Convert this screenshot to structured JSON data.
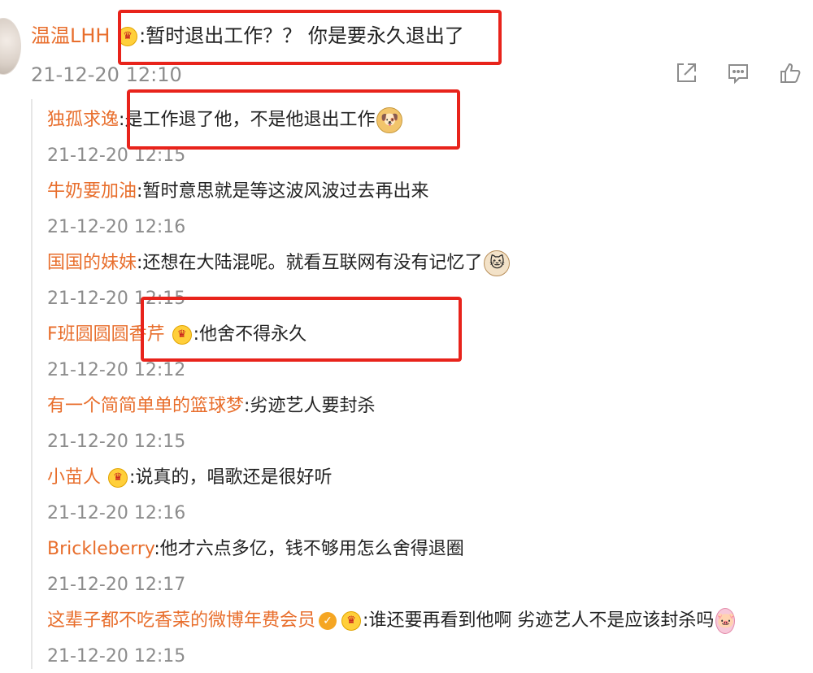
{
  "main_comment": {
    "username": "温温LHH",
    "separator": ":",
    "text": "暂时退出工作？？ 你是要永久退出了",
    "timestamp": "21-12-20 12:10",
    "actions": [
      {
        "icon": "share-icon"
      },
      {
        "icon": "comment-icon"
      },
      {
        "icon": "like-icon"
      }
    ]
  },
  "replies": [
    {
      "username": "独孤求逸",
      "sep": ":",
      "text": "是工作退了他，不是他退出工作",
      "timestamp": "21-12-20 12:15",
      "emoji": "doge-emoji"
    },
    {
      "username": "牛奶要加油",
      "sep": ":",
      "text": "暂时意思就是等这波风波过去再出来",
      "timestamp": "21-12-20 12:16"
    },
    {
      "username": "国国的妹妹",
      "sep": ":",
      "text": "还想在大陆混呢。就看互联网有没有记忆了",
      "timestamp": "21-12-20 12:15",
      "emoji": "cat-emoji"
    },
    {
      "username": "F班圆圆圆香芹",
      "sep": ":",
      "text": "他舍不得永久",
      "timestamp": "21-12-20 12:12",
      "badge": "crown-badge-icon"
    },
    {
      "username": "有一个简简单单的篮球梦",
      "sep": ":",
      "text": "劣迹艺人要封杀",
      "timestamp": "21-12-20 12:15"
    },
    {
      "username": "小苗人",
      "sep": ":",
      "text": "说真的，唱歌还是很好听",
      "timestamp": "21-12-20 12:16",
      "badge": "crown-badge-icon"
    },
    {
      "username": "Brickleberry",
      "sep": ":",
      "text": "他才六点多亿，钱不够用怎么舍得退圈",
      "timestamp": "21-12-20 12:17"
    },
    {
      "username": "这辈子都不吃香菜的微博年费会员",
      "sep": ":",
      "text": "谁还要再看到他啊 劣迹艺人不是应该封杀吗",
      "timestamp": "21-12-20 12:15",
      "badge": "crown-badge-icon",
      "verified": "verified-badge-icon",
      "emoji": "pig-emoji"
    }
  ],
  "highlight_color": "#e8231b",
  "username_color": "#e86e2c"
}
